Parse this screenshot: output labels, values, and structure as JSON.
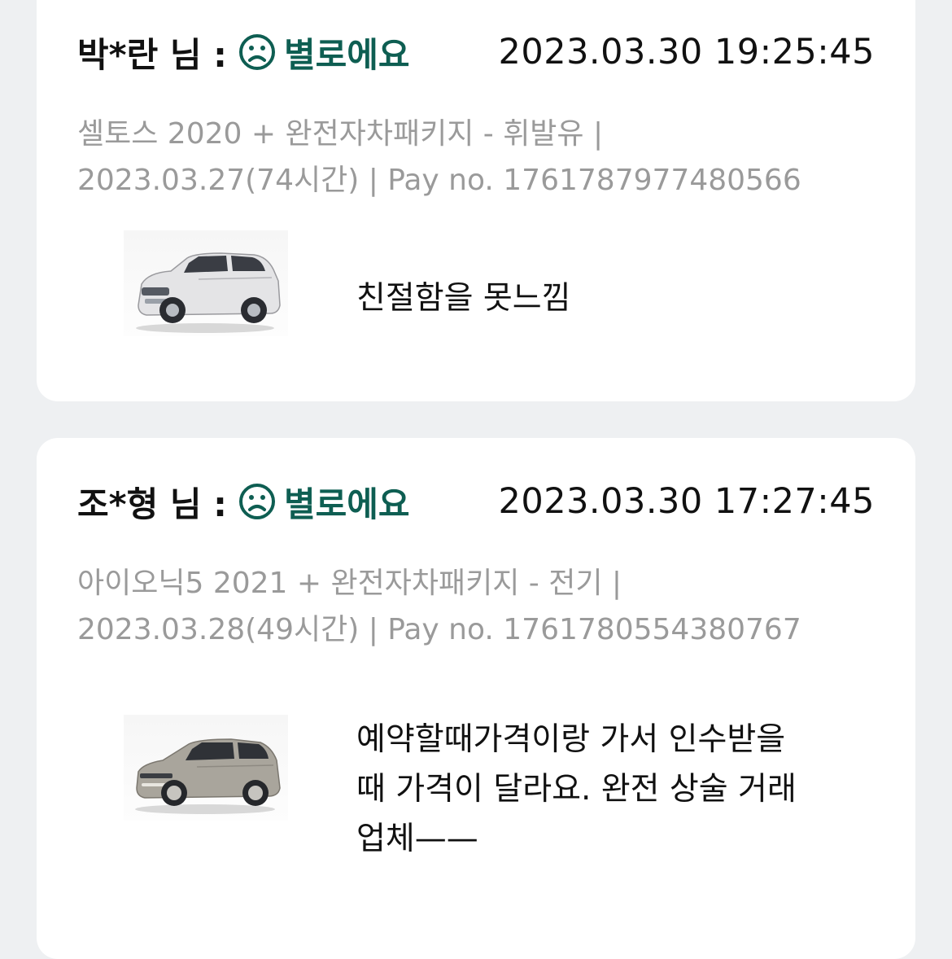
{
  "reviews": [
    {
      "name_label": "박*란 님 :",
      "rating_label": "별로에요",
      "timestamp": "2023.03.30 19:25:45",
      "meta_line1": "셀토스 2020 + 완전자차패키지 - 휘발유 |",
      "meta_line2": "2023.03.27(74시간) | Pay no. 1761787977480566",
      "comment_lines": [
        "친절함을 못느낌"
      ]
    },
    {
      "name_label": "조*형 님 :",
      "rating_label": "별로에요",
      "timestamp": "2023.03.30 17:27:45",
      "meta_line1": "아이오닉5 2021 + 완전자차패키지 - 전기 |",
      "meta_line2": "2023.03.28(49시간) | Pay no. 1761780554380767",
      "comment_lines": [
        "예약할때가격이랑 가서 인수받을",
        "때 가격이 달라요. 완전 상술 거래",
        "업체——"
      ]
    }
  ],
  "colors": {
    "rating_accent": "#0e5e52",
    "meta_gray": "#9a9a9a",
    "background": "#eef0f2",
    "card": "#ffffff"
  },
  "icons": {
    "rating_face": "sad-face-icon",
    "car_1": "white-suv-icon",
    "car_2": "gray-hatchback-ev-icon"
  }
}
